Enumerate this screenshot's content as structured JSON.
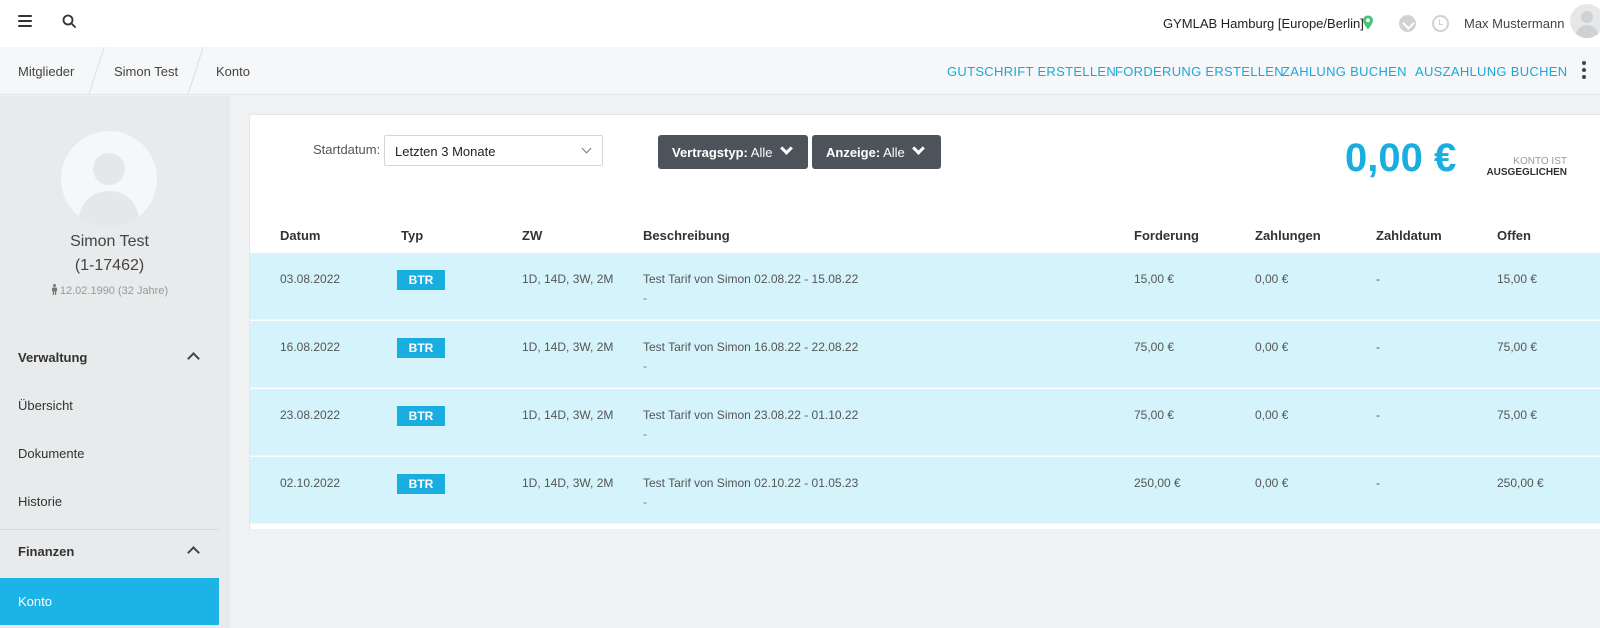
{
  "topbar": {
    "location": "GYMLAB Hamburg [Europe/Berlin]",
    "username": "Max Mustermann"
  },
  "breadcrumb": [
    "Mitglieder",
    "Simon Test",
    "Konto"
  ],
  "actions": [
    "GUTSCHRIFT ERSTELLEN",
    "FORDERUNG ERSTELLEN",
    "ZAHLUNG BUCHEN",
    "AUSZAHLUNG BUCHEN"
  ],
  "member": {
    "name": "Simon Test",
    "id": "(1-17462)",
    "dob": "12.02.1990 (32 Jahre)"
  },
  "sidebar": {
    "section1": "Verwaltung",
    "items1": [
      "Übersicht",
      "Dokumente",
      "Historie"
    ],
    "section2": "Finanzen",
    "active": "Konto"
  },
  "filters": {
    "start_label": "Startdatum:",
    "start_value": "Letzten 3 Monate",
    "vertragstyp_label": "Vertragstyp:",
    "vertragstyp_value": "Alle",
    "anzeige_label": "Anzeige:",
    "anzeige_value": "Alle"
  },
  "balance": {
    "amount": "0,00 €",
    "status_line1": "KONTO IST",
    "status_line2": "AUSGEGLICHEN"
  },
  "table": {
    "headers": [
      "Datum",
      "Typ",
      "ZW",
      "Beschreibung",
      "Forderung",
      "Zahlungen",
      "Zahldatum",
      "Offen"
    ],
    "rows": [
      {
        "datum": "03.08.2022",
        "typ": "BTR",
        "zw": "1D, 14D, 3W, 2M",
        "beschreibung": "Test Tarif von Simon 02.08.22 - 15.08.22",
        "sub": "-",
        "forderung": "15,00 €",
        "zahlungen": "0,00 €",
        "zahldatum": "-",
        "offen": "15,00 €"
      },
      {
        "datum": "16.08.2022",
        "typ": "BTR",
        "zw": "1D, 14D, 3W, 2M",
        "beschreibung": "Test Tarif von Simon 16.08.22 - 22.08.22",
        "sub": "-",
        "forderung": "75,00 €",
        "zahlungen": "0,00 €",
        "zahldatum": "-",
        "offen": "75,00 €"
      },
      {
        "datum": "23.08.2022",
        "typ": "BTR",
        "zw": "1D, 14D, 3W, 2M",
        "beschreibung": "Test Tarif von Simon 23.08.22 - 01.10.22",
        "sub": "-",
        "forderung": "75,00 €",
        "zahlungen": "0,00 €",
        "zahldatum": "-",
        "offen": "75,00 €"
      },
      {
        "datum": "02.10.2022",
        "typ": "BTR",
        "zw": "1D, 14D, 3W, 2M",
        "beschreibung": "Test Tarif von Simon 02.10.22 - 01.05.23",
        "sub": "-",
        "forderung": "250,00 €",
        "zahlungen": "0,00 €",
        "zahldatum": "-",
        "offen": "250,00 €"
      }
    ]
  },
  "colors": {
    "accent": "#1aaee0",
    "row_bg": "#d4f3fb",
    "active_nav": "#1cb3e6",
    "filter_btn": "#4d535a"
  },
  "icons": [
    "menu-icon",
    "search-icon",
    "location-pin-icon",
    "download-icon",
    "clock-icon",
    "avatar",
    "kebab-menu-icon",
    "person-icon",
    "chevron-up-icon",
    "chevron-down-icon"
  ]
}
